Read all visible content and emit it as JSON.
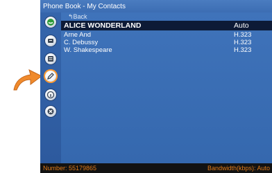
{
  "app": {
    "title": "Phone Book - My Contacts"
  },
  "sidebar": {
    "icons": [
      {
        "name": "call-icon"
      },
      {
        "name": "directory-icon"
      },
      {
        "name": "keypad-icon"
      },
      {
        "name": "edit-icon"
      },
      {
        "name": "info-icon"
      },
      {
        "name": "delete-icon"
      }
    ],
    "selected": "edit-icon"
  },
  "list": {
    "back_label": "Back",
    "items": [
      {
        "name": "ALICE WONDERLAND",
        "protocol": "Auto",
        "selected": true
      },
      {
        "name": "Arne And",
        "protocol": "H.323"
      },
      {
        "name": "C. Debussy",
        "protocol": "H.323"
      },
      {
        "name": "W. Shakespeare",
        "protocol": "H.323"
      }
    ]
  },
  "status": {
    "left": "Number: 55179865",
    "right": "Bandwidth(kbps): Auto"
  },
  "colors": {
    "screen_bg": "#2f5ea6",
    "selected_row_bg": "#0d1a36",
    "status_text": "#e07b1a",
    "pointer_arrow": "#f08a2c"
  }
}
